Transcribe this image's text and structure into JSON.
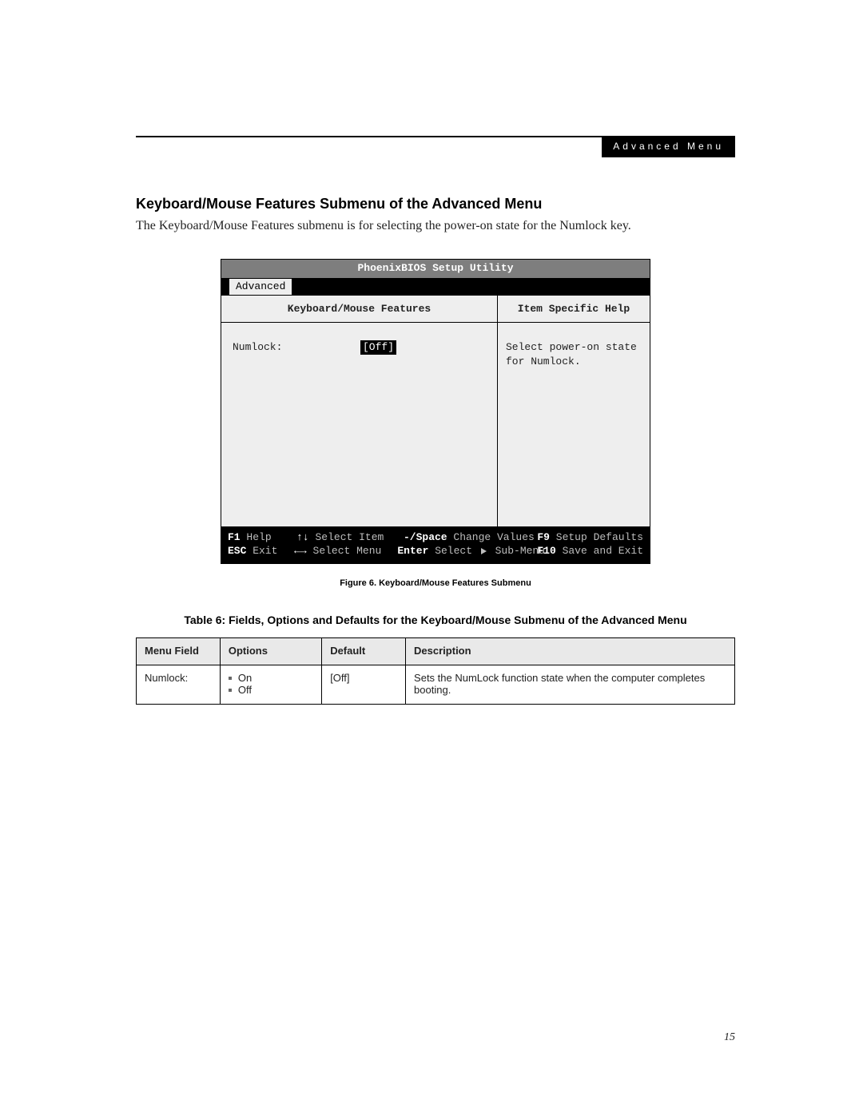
{
  "header": {
    "section_label": "Advanced Menu"
  },
  "section": {
    "heading": "Keyboard/Mouse Features Submenu of the Advanced Menu",
    "intro": "The Keyboard/Mouse Features submenu is for selecting the power-on state for the Numlock key."
  },
  "bios": {
    "title": "PhoenixBIOS Setup Utility",
    "active_tab": "Advanced",
    "left_title": "Keyboard/Mouse Features",
    "right_title": "Item Specific Help",
    "field_label": "Numlock:",
    "field_value": "[Off]",
    "help_line1": "Select power-on state",
    "help_line2": "for Numlock.",
    "footer": {
      "f1": "F1",
      "f1_label": " Help",
      "updown": "↑↓",
      "updown_label": " Select Item",
      "minus": "-/Space",
      "minus_label": " Change Values",
      "f9": "F9",
      "f9_label": " Setup Defaults",
      "esc": "ESC",
      "esc_label": " Exit",
      "lr": "←→",
      "lr_label": " Select Menu",
      "enter": "Enter",
      "enter_label1": " Select ",
      "enter_label2": " Sub-Menu",
      "f10": "F10",
      "f10_label": " Save and Exit"
    }
  },
  "figure_caption": "Figure 6.  Keyboard/Mouse Features Submenu",
  "table_heading": "Table 6: Fields, Options and Defaults for the Keyboard/Mouse Submenu of the Advanced Menu",
  "table": {
    "headers": {
      "c1": "Menu Field",
      "c2": "Options",
      "c3": "Default",
      "c4": "Description"
    },
    "rows": [
      {
        "field": "Numlock:",
        "options": [
          "On",
          "Off"
        ],
        "default": "[Off]",
        "description": "Sets the NumLock function state when the computer completes booting."
      }
    ]
  },
  "page_number": "15"
}
